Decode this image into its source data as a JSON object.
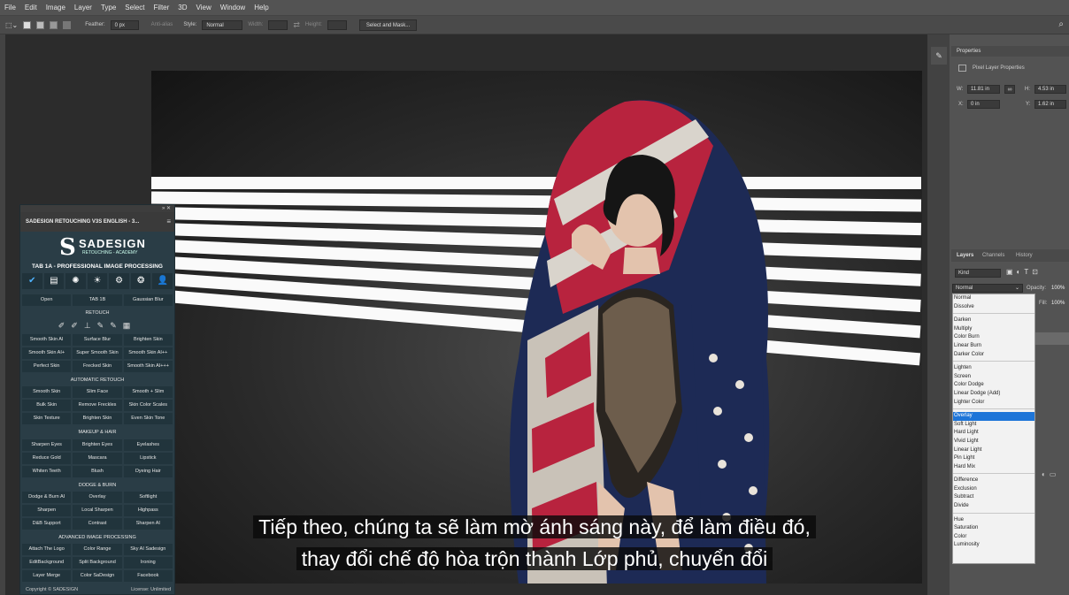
{
  "menu": [
    "File",
    "Edit",
    "Image",
    "Layer",
    "Type",
    "Select",
    "Filter",
    "3D",
    "View",
    "Window",
    "Help"
  ],
  "options": {
    "feather_label": "Feather:",
    "feather_value": "0 px",
    "antialias": "Anti-alias",
    "style_label": "Style:",
    "style_value": "Normal",
    "width_label": "Width:",
    "height_label": "Height:",
    "select_mask": "Select and Mask..."
  },
  "properties": {
    "tab": "Properties",
    "title": "Pixel Layer Properties",
    "w_label": "W:",
    "w_value": "11.81 in",
    "h_label": "H:",
    "h_value": "4.53 in",
    "x_label": "X:",
    "x_value": "0 in",
    "y_label": "Y:",
    "y_value": "1.62 in"
  },
  "layers": {
    "tabs": [
      "Layers",
      "Channels",
      "History"
    ],
    "kind": "Kind",
    "blend_value": "Normal",
    "opacity_label": "Opacity:",
    "opacity_value": "100%",
    "fill_label": "Fill:",
    "fill_value": "100%"
  },
  "blend_groups": [
    [
      "Normal",
      "Dissolve"
    ],
    [
      "Darken",
      "Multiply",
      "Color Burn",
      "Linear Burn",
      "Darker Color"
    ],
    [
      "Lighten",
      "Screen",
      "Color Dodge",
      "Linear Dodge (Add)",
      "Lighter Color"
    ],
    [
      "Overlay",
      "Soft Light",
      "Hard Light",
      "Vivid Light",
      "Linear Light",
      "Pin Light",
      "Hard Mix"
    ],
    [
      "Difference",
      "Exclusion",
      "Subtract",
      "Divide"
    ],
    [
      "Hue",
      "Saturation",
      "Color",
      "Luminosity"
    ]
  ],
  "blend_selected": "Overlay",
  "plugin": {
    "window_title": "SADESIGN RETOUCHING V3S ENGLISH - 3...",
    "brand": "SADESIGN",
    "brand_sub": "RETOUCHING - ACADEMY",
    "tab_title": "TAB 1A - PROFESSIONAL IMAGE PROCESSING",
    "top_buttons": [
      "Open",
      "TAB 1B",
      "Gaussian Blur"
    ],
    "retouch_label": "RETOUCH",
    "retouch_buttons": [
      "Smooth Skin AI",
      "Surface Blur",
      "Brighten Skin",
      "Smooth Skin AI+",
      "Super Smooth Skin",
      "Smooth Skin AI++",
      "Perfect Skin",
      "Frecked Skin",
      "Smooth Skin AI+++"
    ],
    "auto_label": "AUTOMATIC RETOUCH",
    "auto_buttons": [
      "Smooth Skin",
      "Slim Face",
      "Smooth + Slim",
      "Bulk Skin",
      "Remove Freckles",
      "Skin Color Scales",
      "Skin Texture",
      "Brighten Skin",
      "Even Skin Tone"
    ],
    "makeup_label": "MAKEUP & HAIR",
    "makeup_buttons": [
      "Sharpen Eyes",
      "Brighten Eyes",
      "Eyelashes",
      "Reduce Gold",
      "Mascara",
      "Lipstick",
      "Whiten Teeth",
      "Blush",
      "Dyeing Hair"
    ],
    "dodge_label": "DODGE & BURN",
    "dodge_buttons": [
      "Dodge & Burn AI",
      "Overlay",
      "Softlight",
      "Sharpen",
      "Local Sharpen",
      "Highpass",
      "D&B Support",
      "Contrast",
      "Sharpen AI"
    ],
    "advanced_label": "ADVANCED IMAGE PROCESSING",
    "advanced_buttons": [
      "Attach The Logo",
      "Color Range",
      "Sky AI Sadesign",
      "EditBackground",
      "Split Background",
      "Ironing",
      "Layer Merge",
      "Color SaDesign",
      "Facebook"
    ],
    "copyright": "Copyright © SADESIGN",
    "license": "License: Unlimited"
  },
  "caption": {
    "line1": "Tiếp theo, chúng ta sẽ làm mờ ánh sáng này, để làm điều đó,",
    "line2": "thay đổi chế độ hòa trộn thành Lớp phủ, chuyển đổi"
  },
  "colors": {
    "selection": "#1e75d8",
    "plugin_bg": "#2a3d46",
    "flag_red": "#b8233e",
    "flag_navy": "#1d2a55"
  }
}
